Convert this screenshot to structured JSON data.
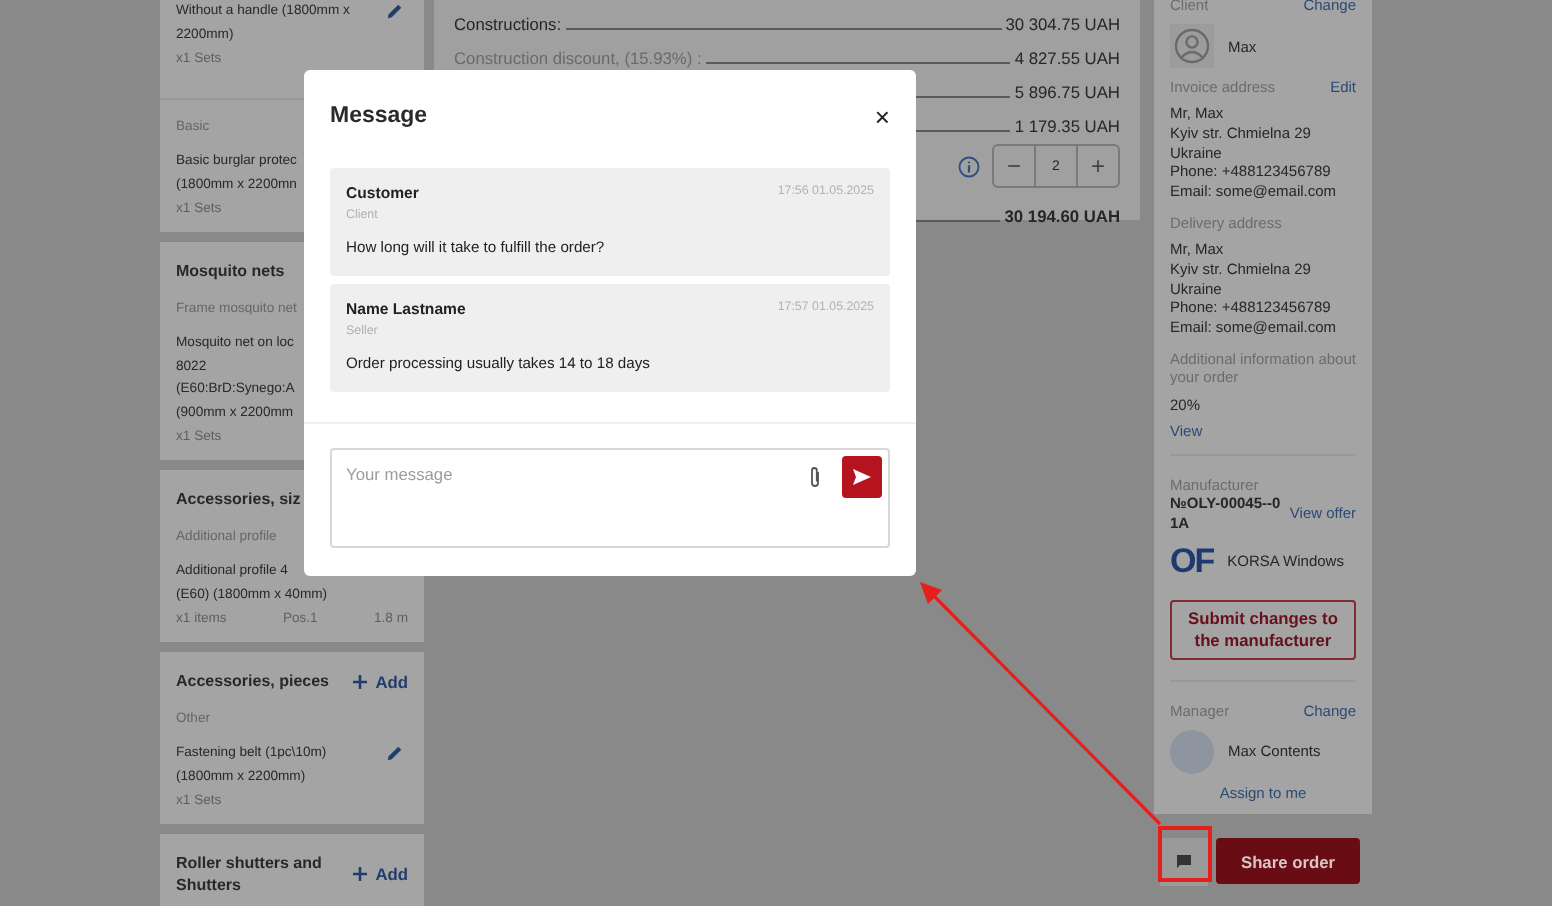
{
  "left_cards": [
    {
      "groups": [
        {
          "items": [
            {
              "lines": [
                "Without a handle (1800mm x",
                "2200mm)"
              ],
              "editable": true,
              "meta": [
                "x1 Sets"
              ]
            }
          ]
        },
        {
          "category": "Basic",
          "items": [
            {
              "lines": [
                "Basic burglar protec",
                "(1800mm x 2200mn"
              ],
              "meta": [
                "x1 Sets"
              ]
            }
          ]
        }
      ]
    },
    {
      "title": "Mosquito nets",
      "groups": [
        {
          "category": "Frame mosquito net",
          "items": [
            {
              "lines": [
                "Mosquito net on loc",
                "8022",
                "(E60:BrD:Synego:A",
                "(900mm x 2200mm"
              ],
              "meta": [
                "x1 Sets"
              ]
            }
          ]
        }
      ]
    },
    {
      "title": "Accessories, siz",
      "groups": [
        {
          "category": "Additional profile",
          "items": [
            {
              "lines": [
                "Additional profile 4",
                "(E60) (1800mm x 40mm)"
              ],
              "meta": [
                "x1 items",
                "Pos.1",
                "1.8 m"
              ]
            }
          ]
        }
      ]
    },
    {
      "title": "Accessories, pieces",
      "action": "Add",
      "groups": [
        {
          "category": "Other",
          "items": [
            {
              "lines": [
                "Fastening belt (1pc\\10m)",
                "(1800mm x 2200mm)"
              ],
              "editable": true,
              "meta": [
                "x1 Sets"
              ]
            }
          ]
        }
      ]
    },
    {
      "title": "Roller shutters and Shutters",
      "action": "Add"
    }
  ],
  "totals": [
    {
      "kind": "row",
      "label": "Constructions:",
      "value": "30 304.75 UAH"
    },
    {
      "kind": "row",
      "label": "Construction discount, (15.93%) :",
      "value": "4 827.55 UAH",
      "muted": true
    },
    {
      "kind": "row",
      "value": "5 896.75 UAH"
    },
    {
      "kind": "row",
      "value": "1 179.35 UAH"
    },
    {
      "kind": "counter",
      "value": "2",
      "minus": "−",
      "plus": "+"
    },
    {
      "kind": "row",
      "value": "30 194.60 UAH",
      "bold": true
    }
  ],
  "side": {
    "client": {
      "label": "Client",
      "action": "Change",
      "name": "Max"
    },
    "invoice": {
      "label": "Invoice address",
      "action": "Edit",
      "lines": [
        "Mr, Max",
        "Kyiv str. Chmielna 29",
        "Ukraine",
        "Phone: +488123456789",
        "Email: some@email.com"
      ]
    },
    "delivery": {
      "label": "Delivery address",
      "lines": [
        "Mr, Max",
        "Kyiv str. Chmielna 29",
        "Ukraine",
        "Phone: +488123456789",
        "Email: some@email.com"
      ]
    },
    "additional": {
      "label": "Additional information about your order",
      "value": "20%",
      "action": "View"
    },
    "manufacturer": {
      "label": "Manufacturer",
      "code": "№OLY-00045--01A",
      "action": "View offer",
      "logo": "OF",
      "name": "KORSA Windows",
      "button": "Submit changes to the manufacturer"
    },
    "manager": {
      "label": "Manager",
      "action": "Change",
      "name": "Max Contents",
      "assign": "Assign to me"
    },
    "share": "Share order"
  },
  "modal": {
    "title": "Message",
    "close": "×",
    "messages": [
      {
        "author": "Customer",
        "role": "Client",
        "time": "17:56 01.05.2025",
        "text": "How long will it take to fulfill the order?"
      },
      {
        "author": "Name Lastname",
        "role": "Seller",
        "time": "17:57 01.05.2025",
        "text": "Order processing usually takes 14 to 18 days"
      }
    ],
    "placeholder": "Your message"
  }
}
